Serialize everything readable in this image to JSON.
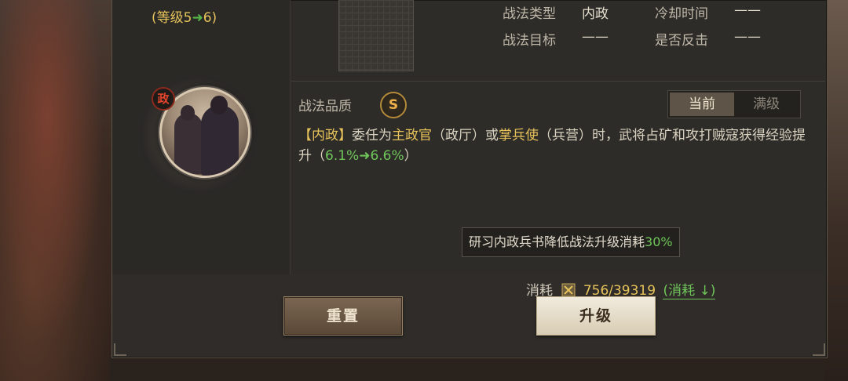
{
  "skill": {
    "level_text_prefix": "(等级5",
    "level_arrow": "➜",
    "level_text_suffix": "6)",
    "portrait_badge": "政"
  },
  "info": {
    "type_label": "战法类型",
    "type_value": "内政",
    "cooldown_label": "冷却时间",
    "cooldown_value": "——",
    "target_label": "战法目标",
    "target_value": "——",
    "counter_label": "是否反击",
    "counter_value": "——"
  },
  "quality": {
    "label": "战法品质",
    "grade": "S"
  },
  "toggle": {
    "current": "当前",
    "max": "满级"
  },
  "description": {
    "tag": "【内政】",
    "p1": "委任为",
    "hl1": "主政官",
    "p2": "（政厅）或",
    "hl2": "掌兵使",
    "p3": "（兵营）时，武将占矿和攻打贼寇获得经验提升（",
    "val_from": "6.1%",
    "arrow": "➜",
    "val_to": "6.6%",
    "p4": "）"
  },
  "hint": {
    "text": "研习内政兵书降低战法升级消耗",
    "value": "30%"
  },
  "cost": {
    "label": "消耗",
    "value": "756/39319",
    "link": "(消耗 ↓)"
  },
  "buttons": {
    "reset": "重置",
    "upgrade": "升级"
  }
}
